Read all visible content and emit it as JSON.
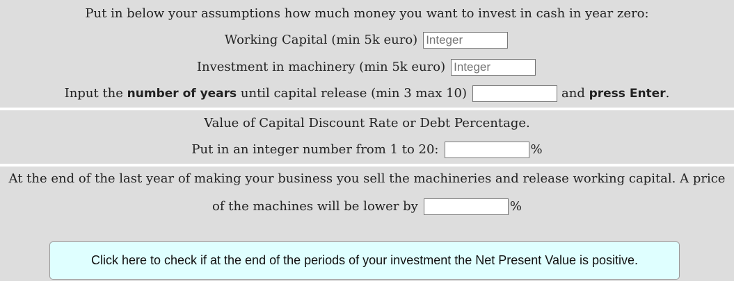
{
  "assumptions": {
    "intro": "Put in below your assumptions how much money you want to invest in cash in year zero:",
    "working_capital_label": "Working Capital (min 5k euro)",
    "working_capital_placeholder": "Integer",
    "machinery_label": "Investment in machinery (min 5k euro)",
    "machinery_placeholder": "Integer",
    "years_prefix": "Input the ",
    "years_bold": "number of years",
    "years_suffix": " until capital release (min 3 max 10)",
    "years_and": "and ",
    "years_press_enter": "press Enter",
    "years_period": "."
  },
  "discount": {
    "title": "Value of Capital Discount Rate or Debt Percentage.",
    "label": "Put in an integer number from 1 to 20:",
    "unit": "%"
  },
  "release": {
    "line1": "At the end of the last year of making your business you sell the machineries and release working capital. A price",
    "line2": "of the machines will be lower by",
    "unit": "%"
  },
  "check_button": {
    "label": "Click here to check if at the end of the periods of your investment the Net Present Value is positive."
  }
}
